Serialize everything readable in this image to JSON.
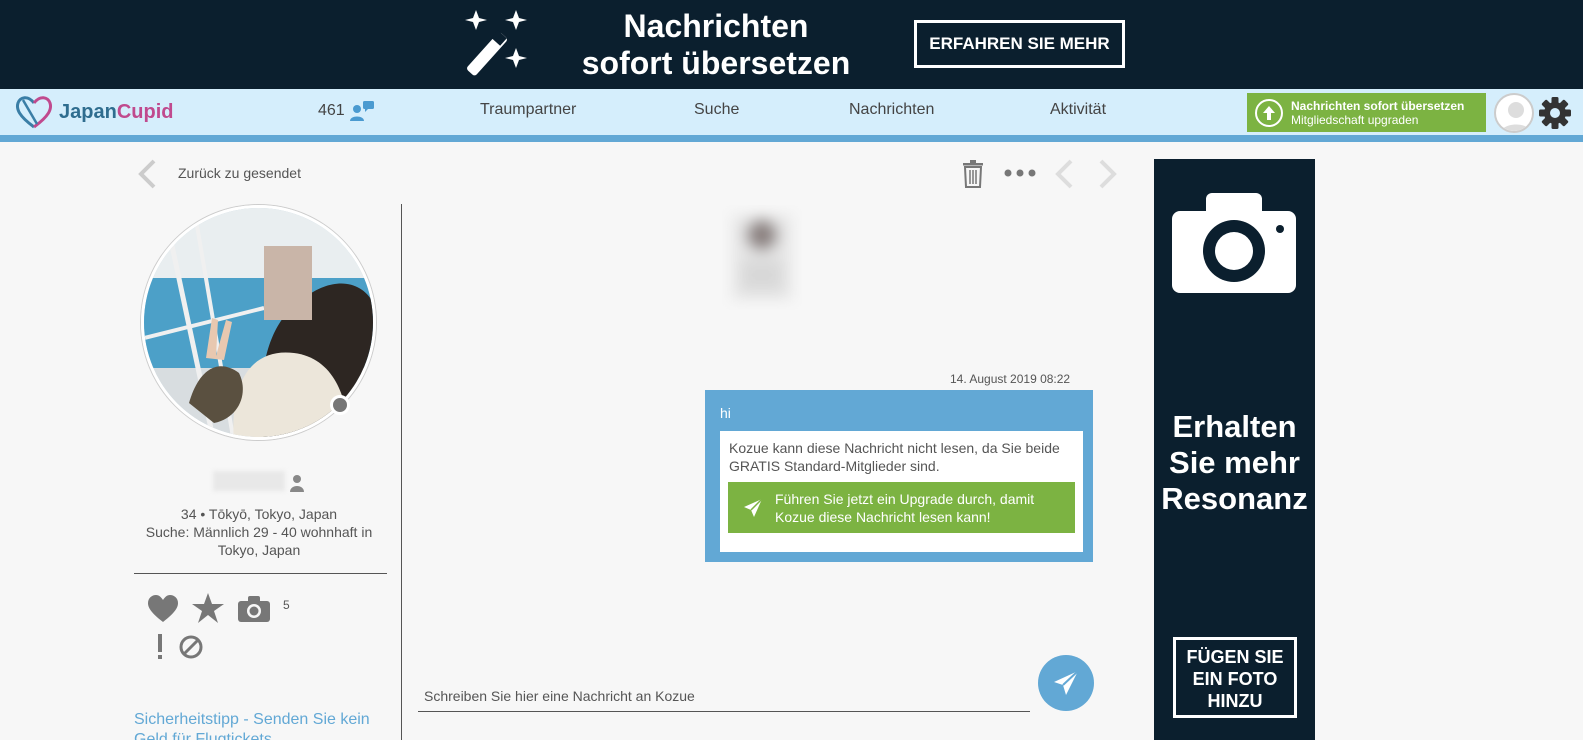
{
  "banner": {
    "title_line1": "Nachrichten",
    "title_line2": "sofort übersetzen",
    "cta": "ERFAHREN SIE MEHR"
  },
  "nav": {
    "logo_part1": "Japan",
    "logo_part2": "Cupid",
    "message_count": "461",
    "items": [
      "Traumpartner",
      "Suche",
      "Nachrichten",
      "Aktivität"
    ],
    "upgrade_title": "Nachrichten sofort übersetzen",
    "upgrade_subtitle": "Mitgliedschaft upgraden"
  },
  "toolbar": {
    "back_label": "Zurück zu gesendet"
  },
  "profile": {
    "info_line1": "34 • Tōkyō, Tokyo, Japan",
    "info_line2": "Suche: Männlich 29 - 40 wohnhaft in Tokyo, Japan",
    "photo_count": "5",
    "safety_tip": "Sicherheitstipp - Senden Sie kein Geld für Flugtickets"
  },
  "chat": {
    "timestamp": "14. August 2019 08:22",
    "message": "hi",
    "notice": "Kozue kann diese Nachricht nicht lesen, da Sie beide GRATIS Standard-Mitglieder sind.",
    "upgrade_button": "Führen Sie jetzt ein Upgrade durch, damit Kozue diese Nachricht lesen kann!",
    "input_placeholder": "Schreiben Sie hier eine Nachricht an Kozue"
  },
  "ad": {
    "title": "Erhalten Sie mehr Resonanz",
    "button": "FÜGEN SIE EIN FOTO HINZU"
  },
  "colors": {
    "dark_navy": "#0b1f2e",
    "nav_bg": "#d5eefc",
    "accent_blue": "#62a8d5",
    "green": "#7cb342"
  },
  "icons": [
    "magic-wand-icon",
    "heart-logo-icon",
    "chat-people-icon",
    "arrow-up-circle-icon",
    "gear-icon",
    "chevron-left-icon",
    "trash-icon",
    "more-dots-icon",
    "chevron-right-icon",
    "person-icon",
    "heart-icon",
    "star-icon",
    "camera-icon",
    "exclamation-icon",
    "block-icon",
    "paper-plane-icon"
  ]
}
